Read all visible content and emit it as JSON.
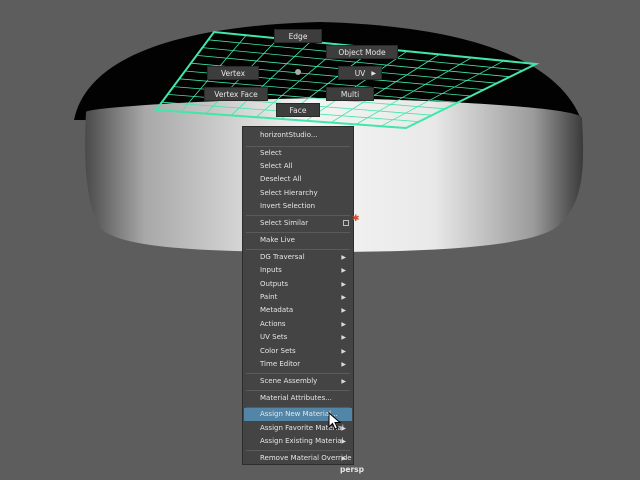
{
  "viewport": {
    "camera": "persp"
  },
  "marking_menu": {
    "edge": "Edge",
    "object_mode": "Object Mode",
    "vertex": "Vertex",
    "uv": "UV",
    "vertex_face": "Vertex Face",
    "multi": "Multi",
    "face": "Face"
  },
  "context_menu": {
    "header": "horizontStudio...",
    "items": [
      {
        "label": "Select"
      },
      {
        "label": "Select All"
      },
      {
        "label": "Deselect All"
      },
      {
        "label": "Select Hierarchy"
      },
      {
        "label": "Invert Selection"
      },
      {
        "label": "Select Similar"
      },
      {
        "label": "Make Live"
      },
      {
        "label": "DG Traversal"
      },
      {
        "label": "Inputs"
      },
      {
        "label": "Outputs"
      },
      {
        "label": "Paint"
      },
      {
        "label": "Metadata"
      },
      {
        "label": "Actions"
      },
      {
        "label": "UV Sets"
      },
      {
        "label": "Color Sets"
      },
      {
        "label": "Time Editor"
      },
      {
        "label": "Scene Assembly"
      },
      {
        "label": "Material Attributes..."
      },
      {
        "label": "Assign New Material..."
      },
      {
        "label": "Assign Favorite Material"
      },
      {
        "label": "Assign Existing Material"
      },
      {
        "label": "Remove Material Override"
      }
    ],
    "highlighted": "Assign New Material..."
  },
  "colors": {
    "background": "#5d5d5d",
    "menu_bg": "#444444",
    "highlight": "#5285a6",
    "grid": "#42e6a8",
    "option_marker": "#d34c2c"
  },
  "icons": [
    "submenu-arrow-icon",
    "option-box-icon",
    "mouse-cursor-icon"
  ]
}
